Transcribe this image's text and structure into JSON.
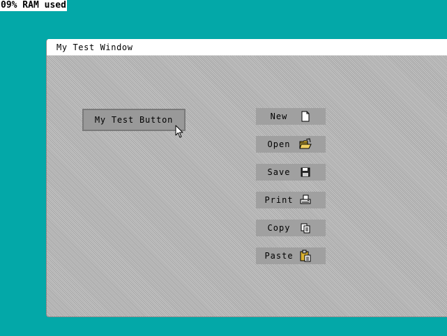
{
  "status": {
    "ram_label": "09% RAM used"
  },
  "window": {
    "title": "My Test Window",
    "main_button_label": "My Test Button"
  },
  "actions": [
    {
      "label": "New",
      "icon": "new-file-icon"
    },
    {
      "label": "Open",
      "icon": "open-folder-icon"
    },
    {
      "label": "Save",
      "icon": "save-floppy-icon"
    },
    {
      "label": "Print",
      "icon": "printer-icon"
    },
    {
      "label": "Copy",
      "icon": "copy-icon"
    },
    {
      "label": "Paste",
      "icon": "paste-clipboard-icon"
    }
  ],
  "colors": {
    "desktop": "#03a8a8",
    "window_pattern_light": "#c8c8c8",
    "window_pattern_dark": "#a4a4a4",
    "button_fill": "#a0a0a0",
    "titlebar": "#ffffff"
  }
}
